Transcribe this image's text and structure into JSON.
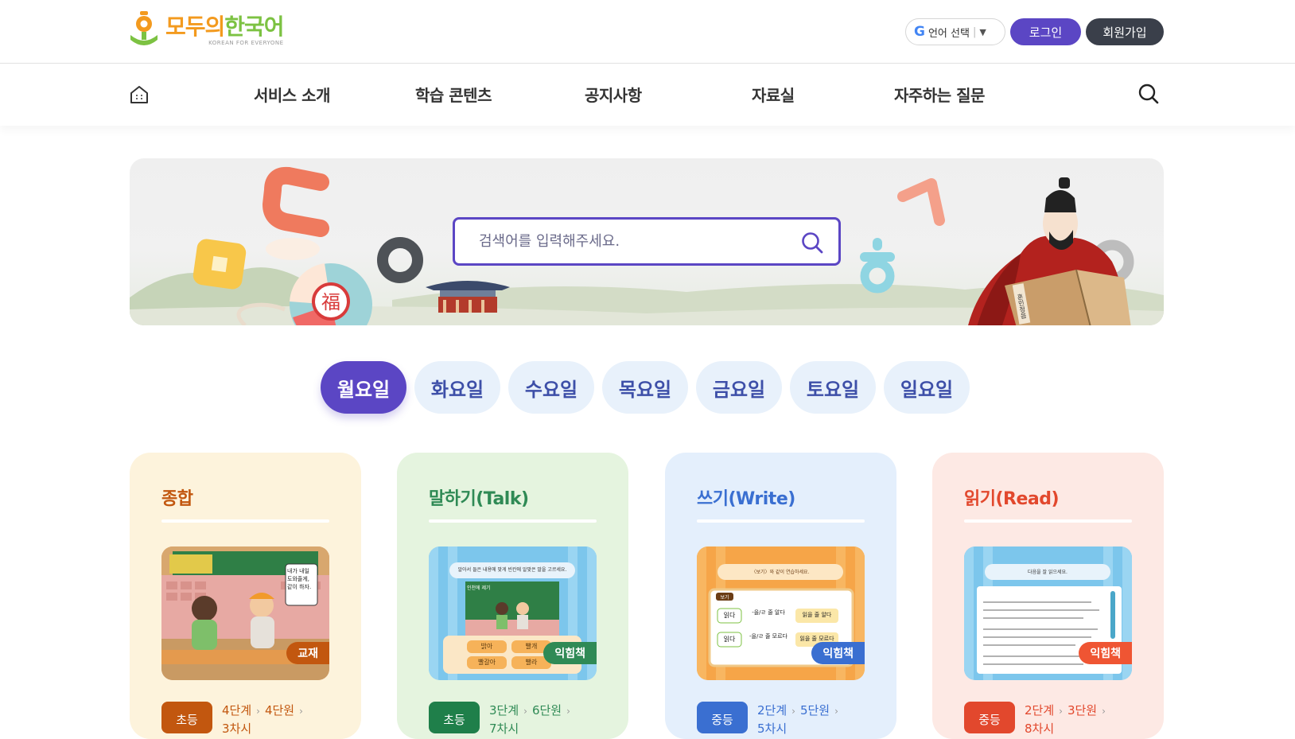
{
  "header": {
    "logo_title_part1": "모두의",
    "logo_title_part2": "한국어",
    "logo_subtitle": "KOREAN FOR EVERYONE",
    "lang_select_label": "언어 선택",
    "login_label": "로그인",
    "join_label": "회원가입"
  },
  "nav": {
    "items": [
      {
        "label": "서비스 소개"
      },
      {
        "label": "학습 콘텐츠"
      },
      {
        "label": "공지사항"
      },
      {
        "label": "자료실"
      },
      {
        "label": "자주하는 질문"
      }
    ]
  },
  "banner": {
    "search_placeholder": "검색어를 입력해주세요.",
    "book_text": "훈민정음",
    "bag_char": "福"
  },
  "days": {
    "active": "월요일",
    "items": [
      {
        "label": "월요일"
      },
      {
        "label": "화요일"
      },
      {
        "label": "수요일"
      },
      {
        "label": "목요일"
      },
      {
        "label": "금요일"
      },
      {
        "label": "토요일"
      },
      {
        "label": "일요일"
      }
    ]
  },
  "cards": [
    {
      "title": "종합",
      "badge": "교재",
      "level": "초등",
      "stage": "4단계",
      "unit": "4단원",
      "lesson": "3차시",
      "thumb_text": "내가 내일 도와줄게, 같이 하자.",
      "bg": "#fdf3dc",
      "accent": "#c2570f",
      "badge_color": "#c2570f",
      "level_color": "#c2570f"
    },
    {
      "title": "말하기(Talk)",
      "badge": "익힘책",
      "level": "초등",
      "stage": "3단계",
      "unit": "6단원",
      "lesson": "7차시",
      "thumb_text": "알아서 들은 내용에 맞게 빈칸에 알맞은 말을 고르세요.",
      "thumb_subtext": "인천에 제기",
      "options": [
        "밝아",
        "빨개",
        "빨갈아",
        "빨라"
      ],
      "bg": "#e5f4df",
      "accent": "#2f8a55",
      "badge_color": "#2f8a55",
      "level_color": "#1f7f4a"
    },
    {
      "title": "쓰기(Write)",
      "badge": "익힘책",
      "level": "중등",
      "stage": "2단계",
      "unit": "5단원",
      "lesson": "5차시",
      "thumb_text": "〈보기〉와 같이 연습하세요.",
      "thumb_box_label": "보기",
      "rows": [
        {
          "word": "읽다",
          "rule": "-을/ㄹ 줄 알다",
          "result": "읽을 줄 알다"
        },
        {
          "word": "읽다",
          "rule": "-을/ㄹ 줄 모르다",
          "result": "읽을 줄 모르다"
        }
      ],
      "bg": "#e4effc",
      "accent": "#3a6fd1",
      "badge_color": "#3a6fd1",
      "level_color": "#3a6fd1"
    },
    {
      "title": "읽기(Read)",
      "badge": "익힘책",
      "level": "중등",
      "stage": "2단계",
      "unit": "3단원",
      "lesson": "8차시",
      "thumb_text": "다음을 잘 읽으세요.",
      "bg": "#fde9e4",
      "accent": "#e2482d",
      "badge_color": "#ef5533",
      "level_color": "#e2482d"
    }
  ],
  "colors": {
    "primary": "#5b46c4",
    "dark_button": "#3a3f4a",
    "day_inactive_bg": "#e8f1fb",
    "day_inactive_text": "#3d4fa8"
  }
}
